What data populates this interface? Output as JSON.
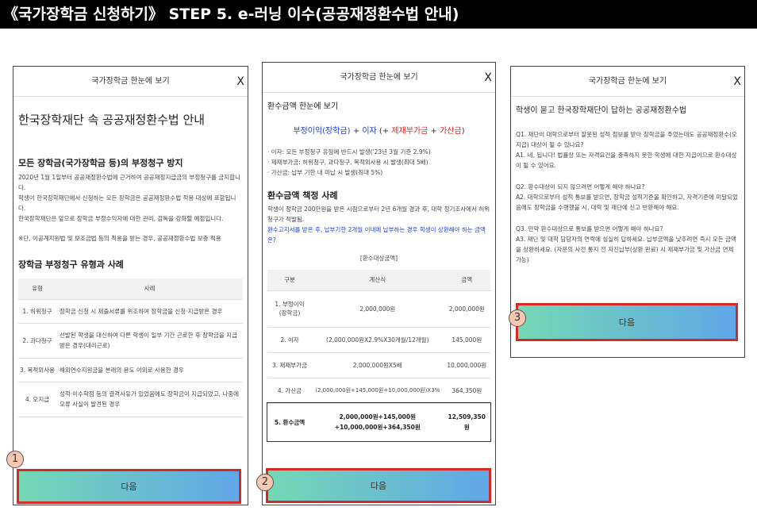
{
  "page_title": "《국가장학금 신청하기》 STEP 5. e-러닝 이수(공공재정환수법 안내)",
  "panel1": {
    "head": "국가장학금 한눈에 보기",
    "close": "X",
    "title": "한국장학재단 속 공공재정환수법 안내",
    "section1_title": "모든 장학금(국가장학금 등)의 부정청구 방지",
    "para1": "2020년 1월 1일부터 공공재정환수법에 근거하여 공공재정지급금의 부정청구를 금지합니다.",
    "para2": "학생이 한국장학재단에서 신청하는 모든 장학금은 공공재정환수법 적용 대상에 포함됩니다.",
    "para3": "한국장학재단은 앞으로 장학금 부정수익자에 대한 관리, 감독을 강화할 예정입니다.",
    "note": "※단, 이공계지원법 및 보조금법 등의 적용을 받는 경우, 공공재정환수법 보충 적용",
    "section2_title": "장학금 부정청구 유형과 사례",
    "table_headers": [
      "유형",
      "사례"
    ],
    "rows": [
      {
        "type": "1. 허위청구",
        "desc": "장학금 신청 시 제출서류를 위조하여 장학금을 신청·지급받은 경우"
      },
      {
        "type": "2. 과다청구",
        "desc": "선발된 학생을 대신하여 다른 학생이 일부 기간 근로한 후 장학금을 지급받은 경우(대리근로)"
      },
      {
        "type": "3. 목적외사용",
        "desc": "해외연수지원금을 본래의 용도 이외로 사용한 경우"
      },
      {
        "type": "4. 오지급",
        "desc": "성적·이수학점 등의 결격사유가 있었음에도 장학금이 지급되었고, 나중에 오류 사실이 발견된 경우"
      }
    ],
    "next": "다음",
    "badge": "1"
  },
  "panel2": {
    "head": "국가장학금 한눈에 보기",
    "close": "X",
    "title": "환수금액 한눈에 보기",
    "formula_a": "부정이익(장학금)",
    "formula_plus1": " + ",
    "formula_b": "이자",
    "formula_plus2": " (+ ",
    "formula_c": "제재부가금",
    "formula_plus3": " + ",
    "formula_d": "가산금",
    "formula_end": ")",
    "bullet1": "· 이자: 모든 부정청구 유형에 반드시 발생('23년 3월 기준 2.9%)",
    "bullet2": "· 제재부가금: 허위청구, 과다청구, 목적외사용 시 발생(최대 5배)",
    "bullet3": "· 가산금: 납부 기한 내 미납 시 발생(최대 5%)",
    "section_title": "환수금액 책정 사례",
    "case1": "학생이 장학금 200만원을 받은 시점으로부터 2년 6개월 경과 후, 대학 정기조사에서 허위청구가 적발됨.",
    "case2": "환수고지서를 받은 후, 납부기한 2개월 이내에 납부하는 경우 학생이 상환해야 하는 금액은?",
    "table_caption": "[환수대상금액]",
    "table_headers": [
      "구분",
      "계산식",
      "금액"
    ],
    "rows": [
      {
        "k": "1. 부정이익(장학금)",
        "f": "2,000,000원",
        "v": "2,000,000원"
      },
      {
        "k": "2. 이자",
        "f": "(2,000,000원X2.9%X30개월/12개월)",
        "v": "145,000원"
      },
      {
        "k": "3. 제재부가금",
        "f": "2,000,000원X5배",
        "v": "10,000,000원"
      },
      {
        "k": "4. 가산금",
        "f": "(2,000,000원+145,000원+10,000,000원)X3%",
        "v": "364,350원"
      }
    ],
    "total": {
      "k": "5. 환수금액",
      "f": "2,000,000원+145,000원+10,000,000원+364,350원",
      "v": "12,509,350원"
    },
    "next": "다음",
    "badge": "2"
  },
  "panel3": {
    "head": "국가장학금 한눈에 보기",
    "close": "X",
    "title": "학생이 묻고 한국장학재단이 답하는 공공재정환수법",
    "q1": "Q1. 재단이 대학으로부터 잘못된 성적 정보를 받아 장학금을 주었는데도 공공재정환수(오지급) 대상이 될 수 있나요?",
    "a1": "A1. 네, 됩니다! 법률상 또는 자격요건을 충족하지 못한 학생에 대한 지급이므로 환수대상이 될 수 있어요.",
    "q2": "Q2. 환수대상이 되지 않으려면 어떻게 해야 하나요?",
    "a2": "A2. 대학으로부터 성적 통보를 받으면, 장학금 성적기준을 확인하고, 자격기준에 미달되었음에도 장학금을 수령했을 시, 대학 및 재단에 신고 반환해야 해요.",
    "q3": "Q3. 만약 환수대상으로 통보를 받으면 어떻게 해야 하나요?",
    "a3": "A3. 재단 및 대학 담당자의 연락에 성실히 답하세요. 납부금액을 낮추려면 즉시 모든 금액을 상환하세요. (자문의 사전 통지 전 자진납부(상환 완료) 시 제재부가금 및 가산금 면제 가능)",
    "next": "다음",
    "badge": "3"
  },
  "colors": {
    "accent_red": "#d42a24",
    "blue": "#1a3fcf",
    "gradient_start": "#74d8b4",
    "gradient_end": "#60a7e8"
  }
}
